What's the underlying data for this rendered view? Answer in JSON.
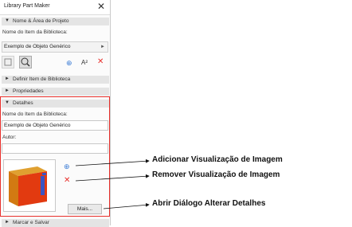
{
  "window": {
    "title": "Library Part Maker",
    "close_glyph": "✕"
  },
  "sections": {
    "nome_area": "Nome & Área de Projeto",
    "definir": "Definir Item de Biblioteca",
    "propriedades": "Propriedades",
    "detalhes": "Detalhes",
    "marcar": "Marcar e Salvar"
  },
  "nome_area": {
    "item_label": "Nome do Item da Biblioteca:",
    "item_value": "Exemplo de Objeto Genérico"
  },
  "toolbar": {
    "add_glyph": "⊕",
    "text_glyph": "A²",
    "delete_glyph": "✕"
  },
  "detalhes": {
    "name_label": "Nome do Item da Biblioteca:",
    "name_value": "Exemplo de Objeto Genérico",
    "author_label": "Autor:",
    "author_value": "",
    "mais_button": "Mais..."
  },
  "annotations": {
    "add_preview": "Adicionar Visualização de Imagem",
    "remove_preview": "Remover Visualização de Imagem",
    "open_details": "Abrir Diálogo Alterar Detalhes"
  },
  "colors": {
    "accent_blue": "#3a7bd5",
    "delete_red": "#e8302c",
    "highlight_border": "#e8302c"
  }
}
